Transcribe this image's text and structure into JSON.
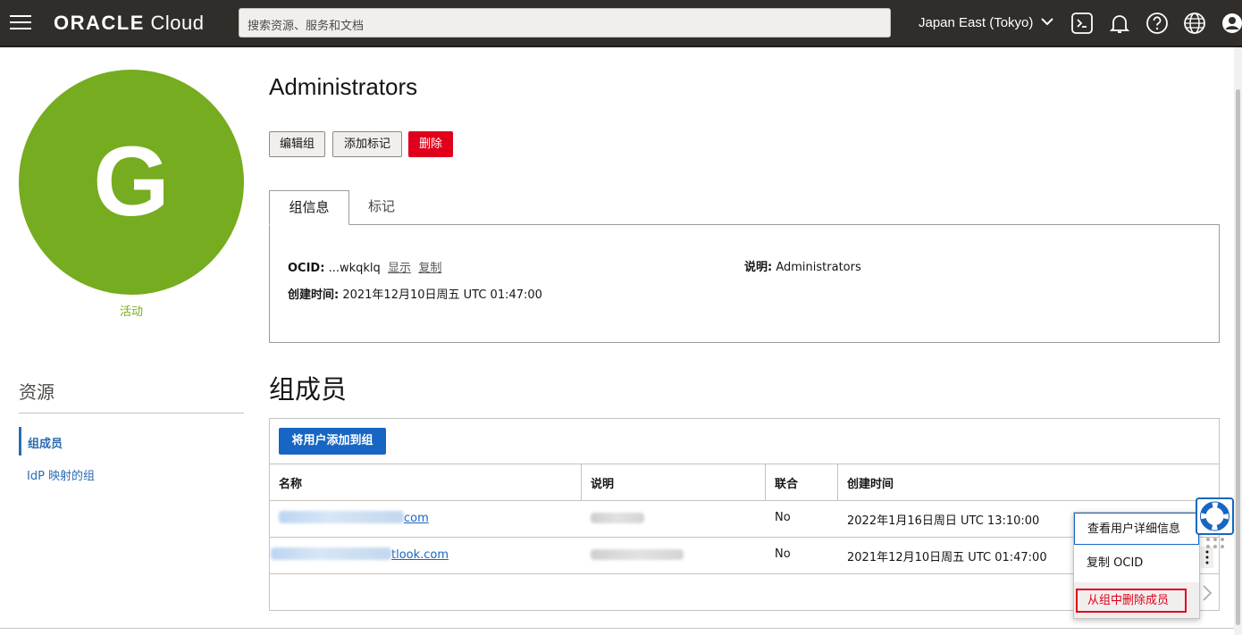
{
  "header": {
    "brand_bold": "ORACLE",
    "brand_light": " Cloud",
    "search_placeholder": "搜索资源、服务和文档",
    "region": "Japan East (Tokyo)",
    "icons": [
      "menu-icon",
      "cloud-shell-icon",
      "bell-icon",
      "help-icon",
      "globe-icon",
      "profile-icon"
    ]
  },
  "sidebar": {
    "avatar_letter": "G",
    "status": "活动",
    "resources_title": "资源",
    "items": [
      {
        "label": "组成员",
        "active": true
      },
      {
        "label": "IdP 映射的组",
        "active": false
      }
    ]
  },
  "main": {
    "title": "Administrators",
    "buttons": {
      "edit": "编辑组",
      "add_tags": "添加标记",
      "delete": "删除"
    },
    "tabs": [
      {
        "label": "组信息",
        "active": true
      },
      {
        "label": "标记",
        "active": false
      }
    ],
    "info": {
      "ocid_label": "OCID:",
      "ocid_value": "...wkqklq",
      "show": "显示",
      "copy": "复制",
      "created_label": "创建时间:",
      "created_value": "2021年12月10日周五 UTC 01:47:00",
      "desc_label": "说明:",
      "desc_value": "Administrators"
    },
    "members": {
      "title": "组成员",
      "add_button": "将用户添加到组",
      "columns": [
        "名称",
        "说明",
        "联合",
        "创建时间"
      ],
      "rows": [
        {
          "name_suffix": "com",
          "federated": "No",
          "created": "2022年1月16日周日 UTC 13:10:00"
        },
        {
          "name_suffix": "tlook.com",
          "federated": "No",
          "created": "2021年12月10日周五 UTC 01:47:00"
        }
      ]
    },
    "context_menu": {
      "items": [
        "查看用户详细信息",
        "复制 OCID",
        "从组中删除成员"
      ]
    }
  },
  "colors": {
    "header_bg": "#312d2a",
    "avatar": "#76ac1f",
    "danger": "#e0001b",
    "primary": "#1766c3",
    "link": "#2b6cb0"
  }
}
